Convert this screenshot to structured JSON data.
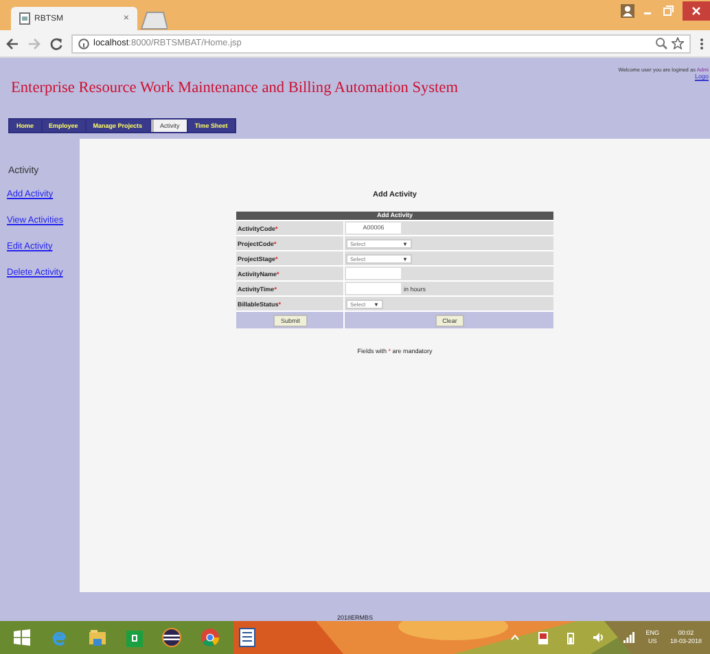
{
  "browser": {
    "tabs": [
      {
        "title": "RBTSM",
        "selected": true
      }
    ],
    "tab_close": "×",
    "address": {
      "host": "localhost",
      "path": ":8000/RBTSMBAT/Home.jsp"
    }
  },
  "header": {
    "title": "Enterprise Resource Work Maintenance and Billing Automation System",
    "welcome": "Welcome  user you are logined as ",
    "user": "Admi",
    "logout": "Logo"
  },
  "nav": [
    {
      "label": "Home",
      "selected": false
    },
    {
      "label": "Employee",
      "selected": false
    },
    {
      "label": "Manage Projects",
      "selected": false
    },
    {
      "label": "Activity",
      "selected": true
    },
    {
      "label": "Time Sheet",
      "selected": false
    }
  ],
  "sidebar": {
    "heading": "Activity",
    "links": [
      "Add Activity",
      "View Activities",
      "Edit Activity",
      "Delete Activity"
    ]
  },
  "form": {
    "title": "Add Activity",
    "table_title": "Add Activity",
    "rows": [
      {
        "label": "ActivityCode",
        "mark": "*",
        "kind": "input",
        "value": "A00006"
      },
      {
        "label": "ProjectCode",
        "mark": "*",
        "kind": "select",
        "value": "Select"
      },
      {
        "label": "ProjectStage",
        "mark": "*",
        "kind": "select",
        "value": "Select"
      },
      {
        "label": "ActivityName",
        "mark": "*",
        "kind": "input"
      },
      {
        "label": "ActivityTime",
        "mark": "*",
        "kind": "input",
        "suffix": "in hours"
      },
      {
        "label": "BillableStatus",
        "mark": "*",
        "kind": "select",
        "value": "Select"
      }
    ],
    "select_arrow": "▼",
    "buttons": [
      "Submit",
      "Clear"
    ],
    "note": {
      "before": "Fields with ",
      "mark": "*",
      "after": " are mandatory"
    }
  },
  "footer": "2018ERMBS",
  "tray": {
    "lang": "ENG",
    "region": "US",
    "time": "00:02",
    "date": "18-03-2018"
  }
}
